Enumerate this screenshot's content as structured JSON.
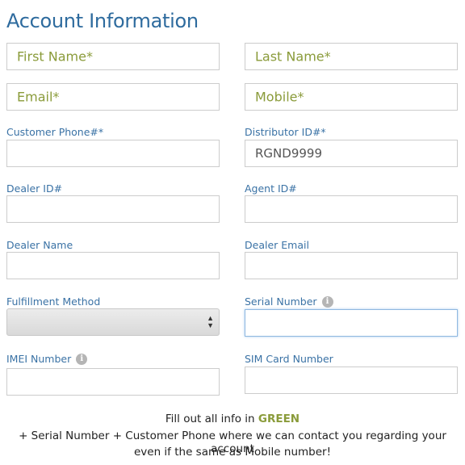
{
  "header": {
    "title": "Account Information"
  },
  "fields": {
    "first_name": {
      "placeholder": "First Name*"
    },
    "last_name": {
      "placeholder": "Last Name*"
    },
    "email": {
      "placeholder": "Email*"
    },
    "mobile": {
      "placeholder": "Mobile*"
    },
    "customer_phone": {
      "label": "Customer Phone#*",
      "value": ""
    },
    "distributor_id": {
      "label": "Distributor ID#*",
      "value": "RGND9999"
    },
    "dealer_id": {
      "label": "Dealer ID#",
      "value": ""
    },
    "agent_id": {
      "label": "Agent ID#",
      "value": ""
    },
    "dealer_name": {
      "label": "Dealer Name",
      "value": ""
    },
    "dealer_email": {
      "label": "Dealer Email",
      "value": ""
    },
    "fulfillment_method": {
      "label": "Fulfillment Method",
      "selected": ""
    },
    "serial_number": {
      "label": "Serial Number",
      "value": ""
    },
    "imei_number": {
      "label": "IMEI Number",
      "value": ""
    },
    "sim_card_number": {
      "label": "SIM Card Number",
      "value": ""
    }
  },
  "footer": {
    "line1_prefix": "Fill out all info in ",
    "line1_highlight": "GREEN",
    "line2": "+ Serial Number + Customer Phone where we can contact you regarding your account",
    "line3": "even if the same as Mobile number!"
  },
  "colors": {
    "title": "#2e6b9e",
    "label": "#3a72a5",
    "placeholder_green": "#8a9b3a",
    "focus_border": "#8fb8e0"
  },
  "icons": {
    "info": "info-icon",
    "select_arrows": "up-down-chevron-icon"
  }
}
